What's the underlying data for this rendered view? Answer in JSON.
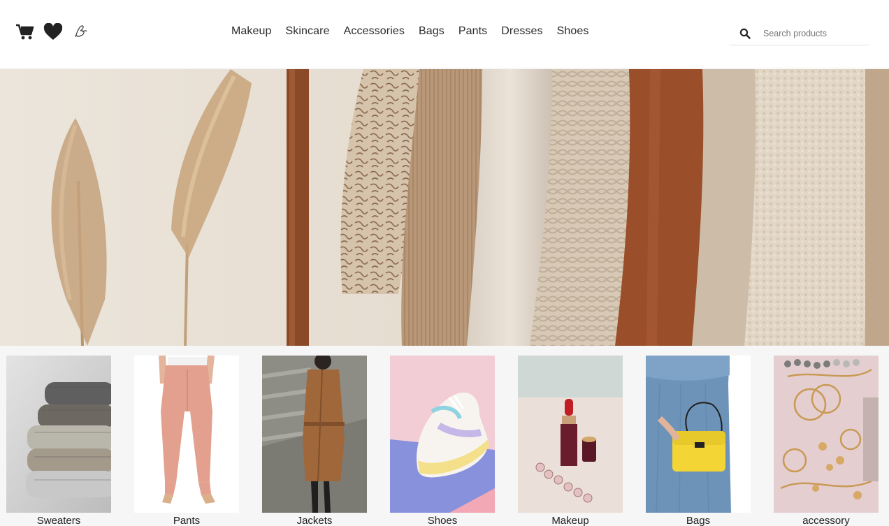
{
  "header": {
    "icons": [
      "cart-icon",
      "heart-icon",
      "logo-icon"
    ],
    "nav": [
      "Makeup",
      "Skincare",
      "Accessories",
      "Bags",
      "Pants",
      "Dresses",
      "Shoes"
    ],
    "search": {
      "placeholder": "Search products",
      "value": "",
      "icon": "search-icon"
    }
  },
  "hero": {},
  "categories": [
    {
      "label": "Sweaters"
    },
    {
      "label": "Pants"
    },
    {
      "label": "Jackets"
    },
    {
      "label": "Shoes"
    },
    {
      "label": "Makeup"
    },
    {
      "label": "Bags"
    },
    {
      "label": "accessory"
    }
  ],
  "colors": {
    "text": "#222222",
    "hero_wall": "#e9e1d6",
    "pampas": "#c9a77f",
    "rail": "#8a4a28"
  }
}
